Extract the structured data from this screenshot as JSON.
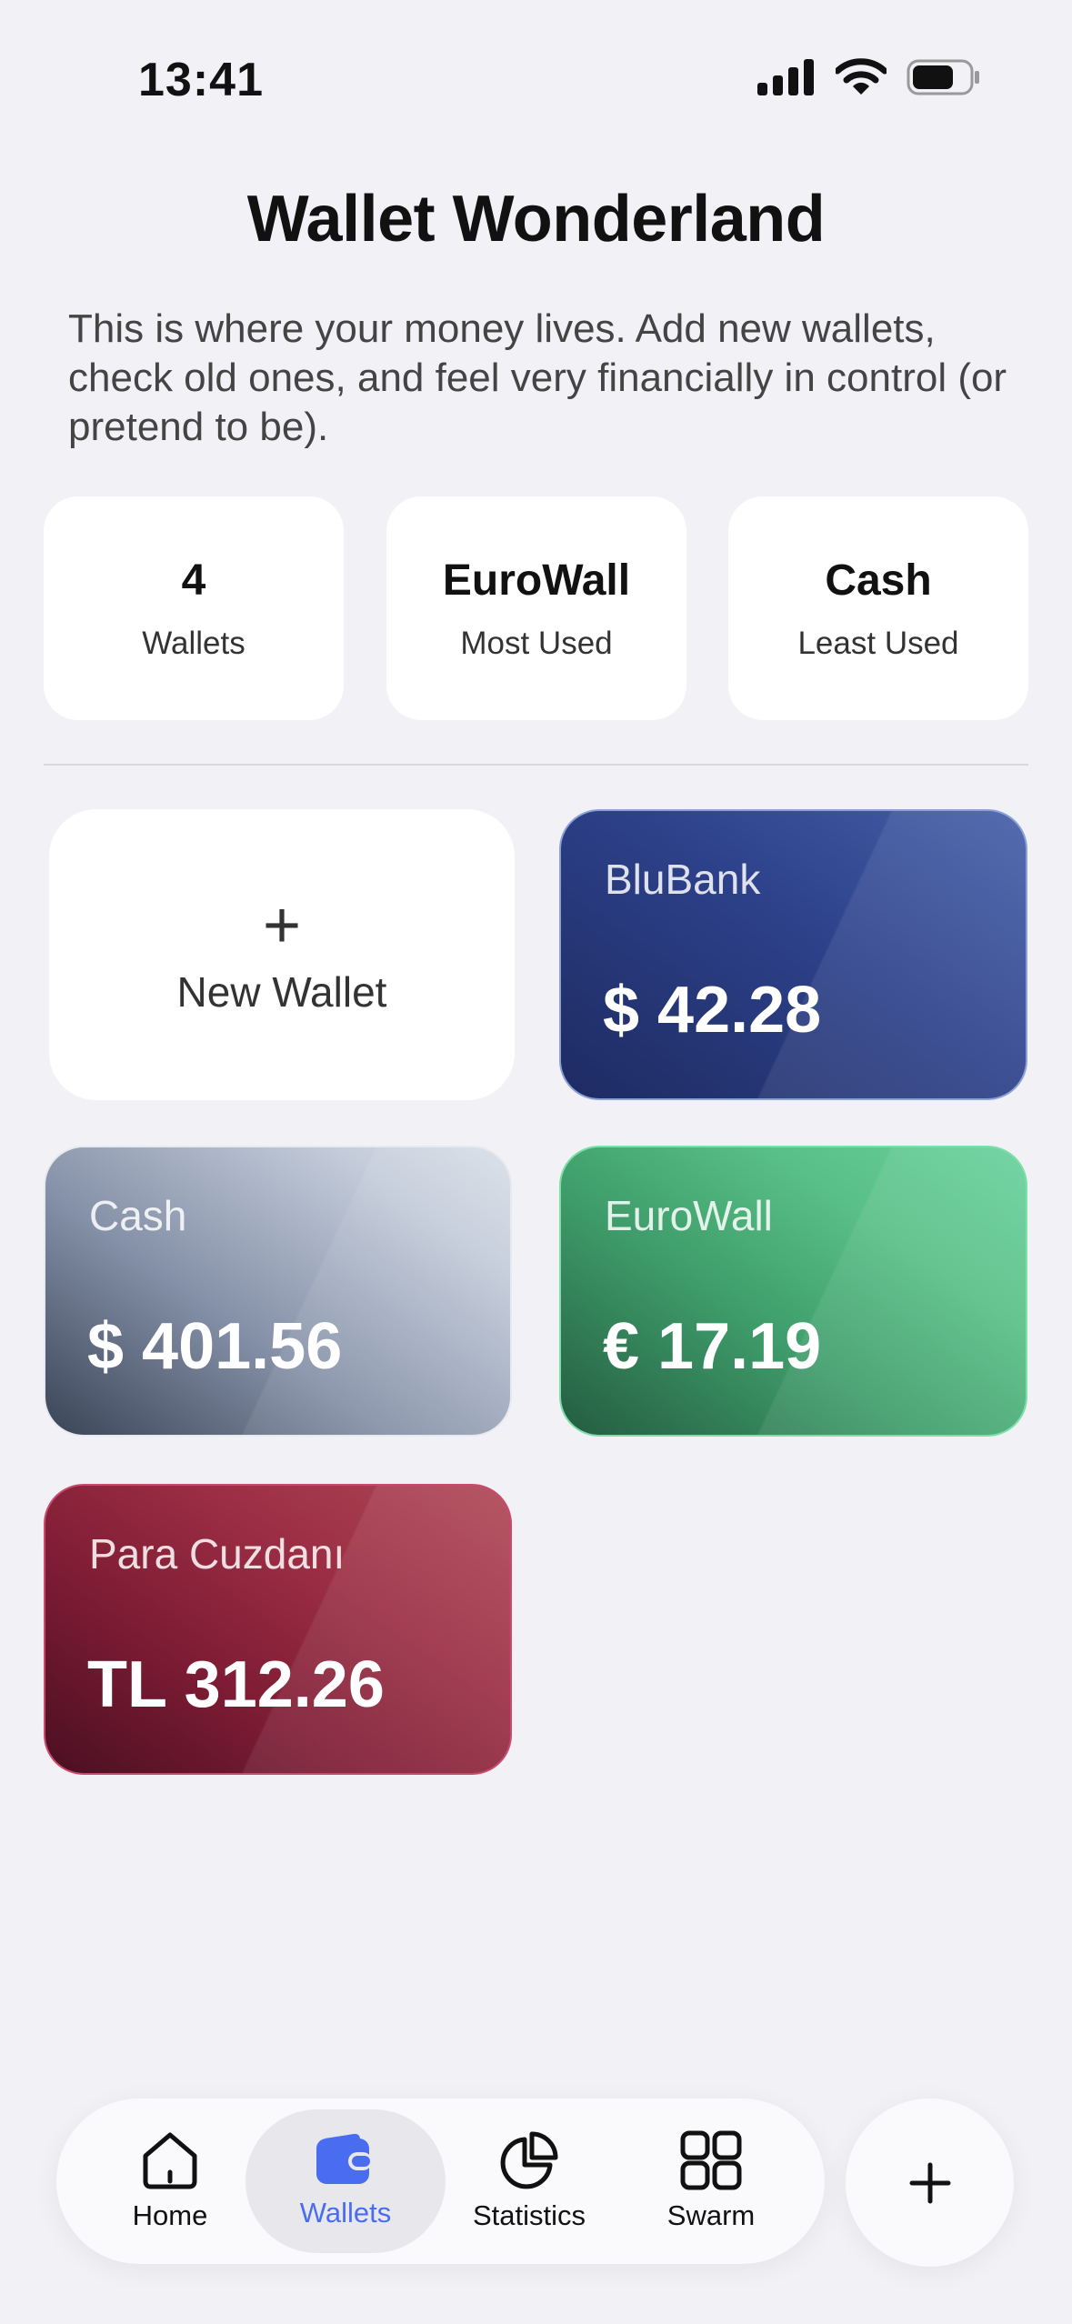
{
  "status": {
    "time": "13:41"
  },
  "header": {
    "title": "Wallet Wonderland",
    "description": "This is where your money lives. Add new wallets, check old ones, and feel very financially in control (or pretend to be)."
  },
  "stats": [
    {
      "value": "4",
      "label": "Wallets"
    },
    {
      "value": "EuroWall",
      "label": "Most Used"
    },
    {
      "value": "Cash",
      "label": "Least Used"
    }
  ],
  "new_wallet": {
    "icon": "plus-icon",
    "label": "New Wallet"
  },
  "wallets": [
    {
      "name": "BluBank",
      "balance": "$ 42.28"
    },
    {
      "name": "Cash",
      "balance": "$ 401.56"
    },
    {
      "name": "EuroWall",
      "balance": "€ 17.19"
    },
    {
      "name": "Para Cuzdanı",
      "balance": "TL 312.26"
    }
  ],
  "tabbar": {
    "tabs": [
      {
        "label": "Home",
        "icon": "home-icon"
      },
      {
        "label": "Wallets",
        "icon": "wallet-icon",
        "active": true
      },
      {
        "label": "Statistics",
        "icon": "pie-chart-icon"
      },
      {
        "label": "Swarm",
        "icon": "grid-icon"
      }
    ],
    "fab_icon": "plus-icon"
  },
  "colors": {
    "accent": "#4a6cf0",
    "background": "#f2f2f6"
  }
}
